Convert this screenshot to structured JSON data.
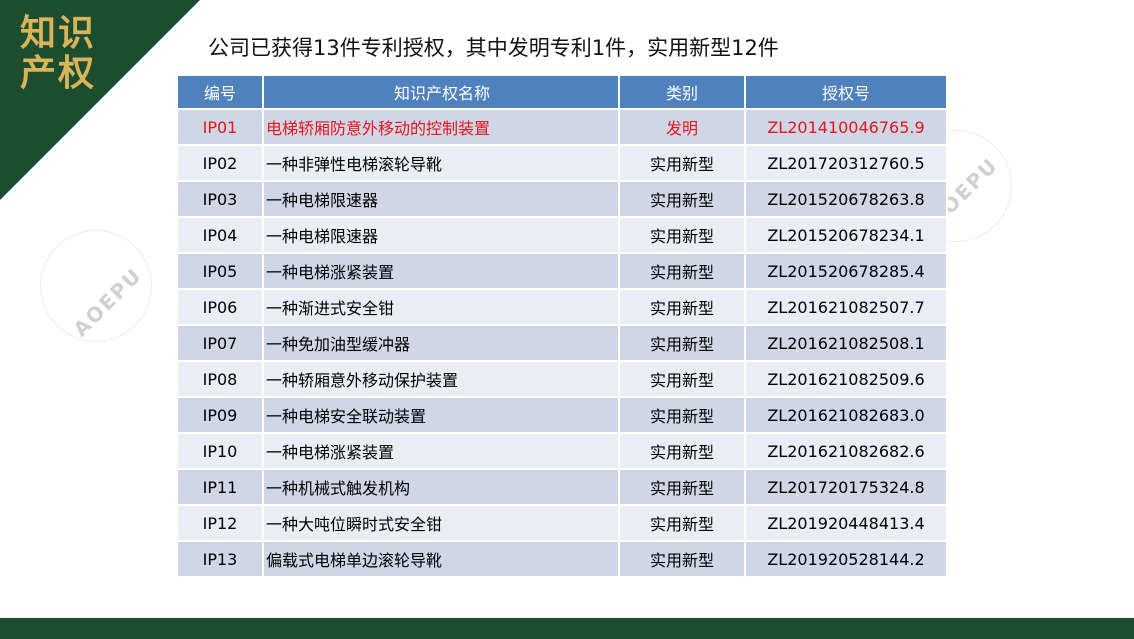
{
  "corner": {
    "title_line1": "知识",
    "title_line2": "产权"
  },
  "heading": "公司已获得13件专利授权，其中发明专利1件，实用新型12件",
  "watermark": "AOEPU",
  "colors": {
    "dark_green": "#1d4d2f",
    "gold": "#d8b45a",
    "header_blue": "#4f81bd",
    "highlight_red": "#e8141d"
  },
  "table": {
    "headers": [
      "编号",
      "知识产权名称",
      "类别",
      "授权号"
    ],
    "rows": [
      {
        "id": "IP01",
        "name": "电梯轿厢防意外移动的控制装置",
        "type": "发明",
        "no": "ZL201410046765.9"
      },
      {
        "id": "IP02",
        "name": "一种非弹性电梯滚轮导靴",
        "type": "实用新型",
        "no": "ZL201720312760.5"
      },
      {
        "id": "IP03",
        "name": "一种电梯限速器",
        "type": "实用新型",
        "no": "ZL201520678263.8"
      },
      {
        "id": "IP04",
        "name": "一种电梯限速器",
        "type": "实用新型",
        "no": "ZL201520678234.1"
      },
      {
        "id": "IP05",
        "name": "一种电梯涨紧装置",
        "type": "实用新型",
        "no": "ZL201520678285.4"
      },
      {
        "id": "IP06",
        "name": "一种渐进式安全钳",
        "type": "实用新型",
        "no": "ZL201621082507.7"
      },
      {
        "id": "IP07",
        "name": "一种免加油型缓冲器",
        "type": "实用新型",
        "no": "ZL201621082508.1"
      },
      {
        "id": "IP08",
        "name": "一种轿厢意外移动保护装置",
        "type": "实用新型",
        "no": "ZL201621082509.6"
      },
      {
        "id": "IP09",
        "name": "一种电梯安全联动装置",
        "type": "实用新型",
        "no": "ZL201621082683.0"
      },
      {
        "id": "IP10",
        "name": "一种电梯涨紧装置",
        "type": "实用新型",
        "no": "ZL201621082682.6"
      },
      {
        "id": "IP11",
        "name": "一种机械式触发机构",
        "type": "实用新型",
        "no": "ZL201720175324.8"
      },
      {
        "id": "IP12",
        "name": "一种大吨位瞬时式安全钳",
        "type": "实用新型",
        "no": "ZL201920448413.4"
      },
      {
        "id": "IP13",
        "name": "偏载式电梯单边滚轮导靴",
        "type": "实用新型",
        "no": "ZL201920528144.2"
      }
    ]
  }
}
